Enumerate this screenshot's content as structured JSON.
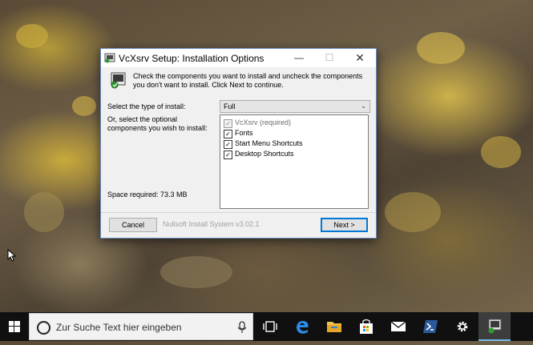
{
  "window": {
    "title": "VcXsrv Setup: Installation Options",
    "header_text": "Check the components you want to install and uncheck the components you don't want to install. Click Next to continue.",
    "install_type_label": "Select the type of install:",
    "install_type_value": "Full",
    "optional_label": "Or, select the optional components you wish to install:",
    "components": [
      {
        "label": "VcXsrv (required)",
        "checked": true,
        "disabled": true
      },
      {
        "label": "Fonts",
        "checked": true,
        "disabled": false
      },
      {
        "label": "Start Menu Shortcuts",
        "checked": true,
        "disabled": false
      },
      {
        "label": "Desktop Shortcuts",
        "checked": true,
        "disabled": false
      }
    ],
    "space_required": "Space required: 73.3 MB",
    "cancel_label": "Cancel",
    "next_label": "Next >",
    "nsis_text": "Nullsoft Install System v3.02.1"
  },
  "taskbar": {
    "search_placeholder": "Zur Suche Text hier eingeben",
    "accent": "#76b9ed",
    "icons": [
      "windows-start-icon",
      "cortana-icon",
      "microphone-icon",
      "task-view-icon",
      "edge-icon",
      "file-explorer-icon",
      "store-icon",
      "mail-icon",
      "powershell-icon",
      "settings-icon",
      "vcxsrv-setup-icon"
    ]
  }
}
